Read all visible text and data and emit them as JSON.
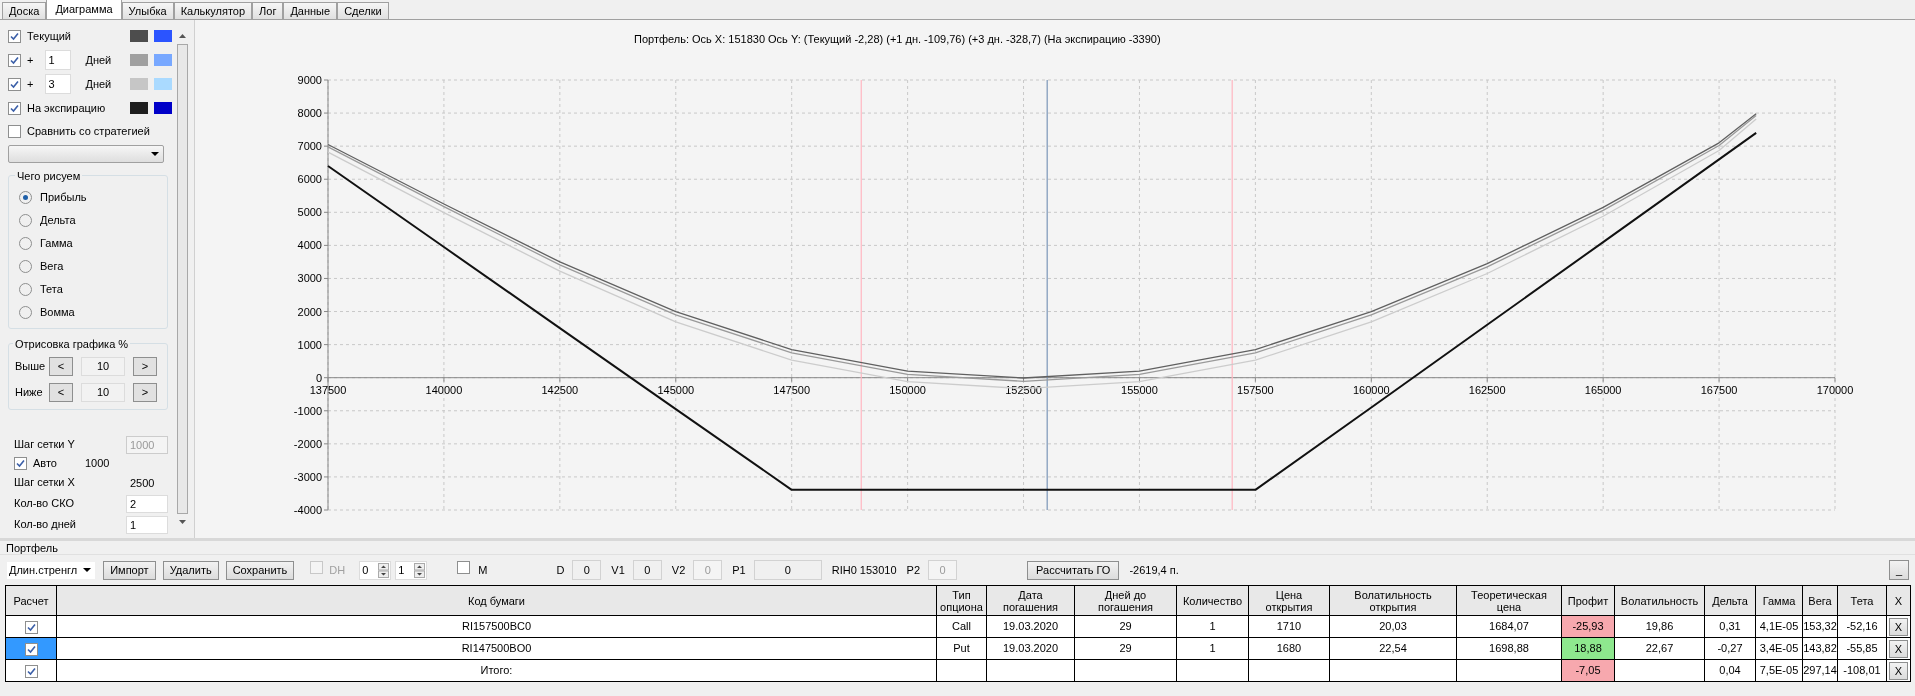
{
  "tabs": [
    {
      "label": "Доска",
      "selected": false
    },
    {
      "label": "Диаграмма",
      "selected": true
    },
    {
      "label": "Улыбка",
      "selected": false
    },
    {
      "label": "Калькулятор",
      "selected": false
    },
    {
      "label": "Лог",
      "selected": false
    },
    {
      "label": "Данные",
      "selected": false
    },
    {
      "label": "Сделки",
      "selected": false
    }
  ],
  "chart_settings": {
    "series_rows": [
      {
        "kind": "plain",
        "label": "Текущий",
        "checked": true,
        "swatches": [
          {
            "color": "#4d4d4d"
          },
          {
            "color": "#2b54ff"
          }
        ]
      },
      {
        "kind": "days",
        "prefix": "+",
        "value": "1",
        "unit": "Дней",
        "checked": true,
        "swatches": [
          {
            "color": "#a0a0a0"
          },
          {
            "color": "#78a8ff"
          }
        ]
      },
      {
        "kind": "days",
        "prefix": "+",
        "value": "3",
        "unit": "Дней",
        "checked": true,
        "swatches": [
          {
            "color": "#c6c6c6"
          },
          {
            "color": "#aadaff"
          }
        ]
      },
      {
        "kind": "plain",
        "label": "На экспирацию",
        "checked": true,
        "swatches": [
          {
            "color": "#1e1e1e"
          },
          {
            "color": "#0000c8"
          }
        ]
      }
    ],
    "compare": {
      "label": "Сравнить со стратегией",
      "checked": false
    },
    "plot_group": {
      "title": "Чего рисуем",
      "options": [
        {
          "label": "Прибыль",
          "selected": true
        },
        {
          "label": "Дельта",
          "selected": false
        },
        {
          "label": "Гамма",
          "selected": false
        },
        {
          "label": "Вега",
          "selected": false
        },
        {
          "label": "Тета",
          "selected": false
        },
        {
          "label": "Вомма",
          "selected": false
        }
      ]
    },
    "range_group": {
      "title": "Отрисовка графика %",
      "rows": [
        {
          "label": "Выше",
          "value": "10",
          "dec": "<",
          "inc": ">"
        },
        {
          "label": "Ниже",
          "value": "10",
          "dec": "<",
          "inc": ">"
        }
      ]
    },
    "grid_settings": [
      {
        "kind": "field",
        "label": "Шаг сетки Y",
        "value": "1000",
        "disabled": true
      },
      {
        "kind": "checkbox",
        "label": "Авто",
        "checked": true,
        "value": "1000"
      },
      {
        "kind": "field",
        "label": "Шаг сетки X",
        "value": "2500",
        "disabled": false,
        "readonly": true
      },
      {
        "kind": "field",
        "label": "Кол-во СКО",
        "value": "2",
        "disabled": false,
        "readonly": false
      },
      {
        "kind": "field",
        "label": "Кол-во дней",
        "value": "1",
        "disabled": false,
        "readonly": false
      }
    ]
  },
  "chart": {
    "chart_data": {
      "type": "line",
      "title": "Портфель: Ось X:  151830 Ось Y:  (Текущий -2,28)  (+1 дн. -109,76)  (+3 дн. -328,7)  (На экспирацию -3390)",
      "x": [
        137500,
        140000,
        142500,
        145000,
        147500,
        150000,
        152500,
        155000,
        157500,
        160000,
        162500,
        165000,
        167500,
        168300
      ],
      "series": [
        {
          "color": "#606060",
          "values": [
            7050,
            5250,
            3500,
            2000,
            850,
            200,
            -10,
            200,
            850,
            2000,
            3450,
            5150,
            7100,
            7980
          ]
        },
        {
          "color": "#9a9a9a",
          "values": [
            6980,
            5170,
            3410,
            1900,
            750,
            100,
            -110,
            100,
            750,
            1900,
            3350,
            5060,
            7020,
            7930
          ]
        },
        {
          "color": "#cccccc",
          "values": [
            6820,
            4990,
            3220,
            1690,
            530,
            -120,
            -330,
            -120,
            530,
            1690,
            3150,
            4880,
            6870,
            7820
          ]
        },
        {
          "color": "#111111",
          "values": [
            6400,
            3950,
            1500,
            -950,
            -3390,
            -3390,
            -3390,
            -3390,
            -3390,
            -900,
            1600,
            4100,
            6600,
            7400
          ]
        }
      ],
      "grid": true,
      "xlim": [
        137500,
        170000
      ],
      "ylim": [
        -4000,
        9000
      ],
      "xticks": [
        137500,
        140000,
        142500,
        145000,
        147500,
        150000,
        152500,
        155000,
        157500,
        160000,
        162500,
        165000,
        167500,
        170000
      ],
      "yticks": [
        -4000,
        -3000,
        -2000,
        -1000,
        0,
        1000,
        2000,
        3000,
        4000,
        5000,
        6000,
        7000,
        8000,
        9000
      ],
      "ref_lines": [
        {
          "axis": "x",
          "value": 149000,
          "color": "#ffb6c1"
        },
        {
          "axis": "x",
          "value": 157000,
          "color": "#ffb6c1"
        },
        {
          "axis": "x",
          "value": 153010,
          "color": "#7b96b8"
        }
      ]
    }
  },
  "portfolio": {
    "title": "Портфель",
    "strategy": "Длин.стренгл",
    "buttons": [
      "Импорт",
      "Удалить",
      "Сохранить"
    ],
    "dh": {
      "label": "DH",
      "checked": false,
      "disabled": true
    },
    "spins": [
      "0",
      "1"
    ],
    "m": {
      "label": "M",
      "checked": false
    },
    "fields": [
      {
        "kind": "field",
        "label": "D",
        "value": "0",
        "disabled": false
      },
      {
        "kind": "field",
        "label": "V1",
        "value": "0",
        "disabled": false
      },
      {
        "kind": "field",
        "label": "V2",
        "value": "0",
        "disabled": true
      },
      {
        "kind": "field",
        "label": "P1",
        "value": "0",
        "disabled": false
      },
      {
        "kind": "text",
        "label": "RIH0 153010"
      },
      {
        "kind": "field",
        "label": "P2",
        "value": "0",
        "disabled": true
      }
    ],
    "calc_button": "Рассчитать ГО",
    "go_value": "-2619,4 п.",
    "minimize": "_"
  },
  "table": {
    "columns": [
      "Расчет",
      "Код бумаги",
      "Тип\nопциона",
      "Дата\nпогашения",
      "Дней до\nпогашения",
      "Количество",
      "Цена\nоткрытия",
      "Волатильность\nоткрытия",
      "Теоретическая\nцена",
      "Профит",
      "Волатильность",
      "Дельта",
      "Гамма",
      "Вега",
      "Тета",
      "X"
    ],
    "rows": [
      {
        "selected": false,
        "checked": true,
        "color": "#f7a8ae",
        "cells": [
          "",
          "RI157500BC0",
          "Call",
          "19.03.2020",
          "29",
          "1",
          "1710",
          "20,03",
          "1684,07",
          "-25,93",
          "19,86",
          "0,31",
          "4,1E-05",
          "153,32",
          "-52,16",
          "X"
        ]
      },
      {
        "selected": true,
        "checked": true,
        "color": "#8ee88e",
        "cells": [
          "",
          "RI147500BO0",
          "Put",
          "19.03.2020",
          "29",
          "1",
          "1680",
          "22,54",
          "1698,88",
          "18,88",
          "22,67",
          "-0,27",
          "3,4E-05",
          "143,82",
          "-55,85",
          "X"
        ]
      },
      {
        "selected": false,
        "checked": true,
        "color": "#f7a8ae",
        "cells": [
          "",
          "Итого:",
          "",
          "",
          "",
          "",
          "",
          "",
          "",
          "-7,05",
          "",
          "0,04",
          "7,5E-05",
          "297,14",
          "-108,01",
          "X"
        ]
      }
    ]
  }
}
